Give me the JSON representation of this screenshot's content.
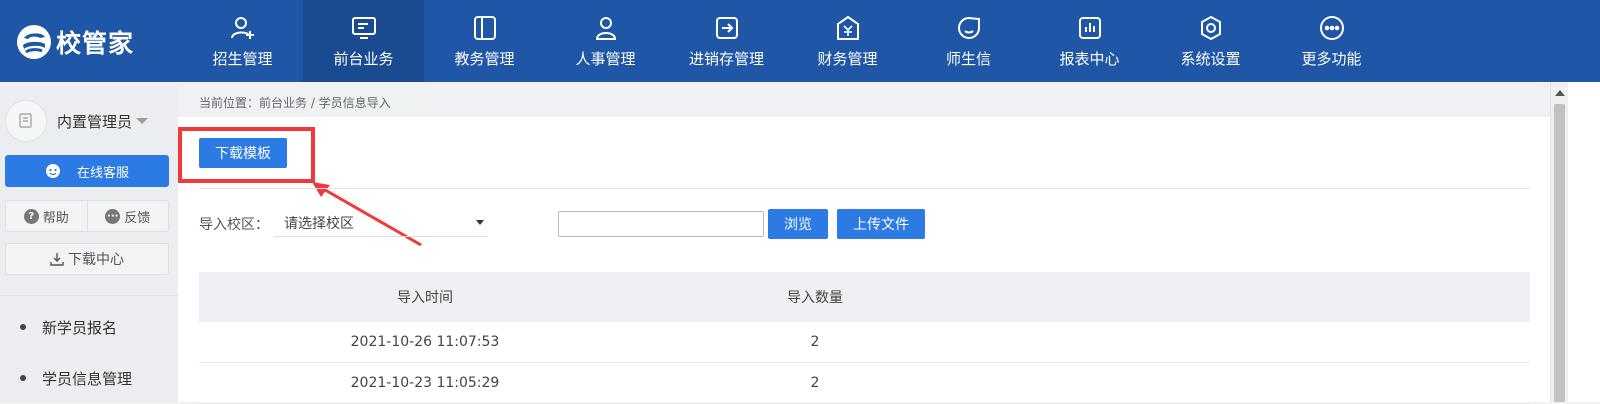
{
  "app": {
    "logo_text": "校管家"
  },
  "nav": [
    {
      "label": "招生管理",
      "icon": "add-user-icon"
    },
    {
      "label": "前台业务",
      "icon": "front-desk-icon",
      "active": true
    },
    {
      "label": "教务管理",
      "icon": "academic-icon"
    },
    {
      "label": "人事管理",
      "icon": "person-icon"
    },
    {
      "label": "进销存管理",
      "icon": "inventory-icon"
    },
    {
      "label": "财务管理",
      "icon": "finance-icon"
    },
    {
      "label": "师生信",
      "icon": "message-icon"
    },
    {
      "label": "报表中心",
      "icon": "report-icon"
    },
    {
      "label": "系统设置",
      "icon": "settings-icon"
    },
    {
      "label": "更多功能",
      "icon": "more-icon"
    }
  ],
  "sidebar": {
    "username": "内置管理员",
    "service_label": "在线客服",
    "help_label": "帮助",
    "feedback_label": "反馈",
    "download_center_label": "下载中心",
    "menu": [
      "新学员报名",
      "学员信息管理"
    ]
  },
  "main": {
    "breadcrumb": "当前位置：前台业务 / 学员信息导入",
    "download_template_label": "下载模板",
    "campus_label": "导入校区：",
    "campus_placeholder": "请选择校区",
    "file_value": "",
    "browse_label": "浏览",
    "upload_label": "上传文件",
    "table": {
      "headers": [
        "导入时间",
        "导入数量"
      ],
      "rows": [
        [
          "2021-10-26 11:07:53",
          "2"
        ],
        [
          "2021-10-23 11:05:29",
          "2"
        ]
      ]
    }
  },
  "colors": {
    "topbar": "#1f57a6",
    "accent": "#2c7be5",
    "highlight": "#f0393a"
  }
}
